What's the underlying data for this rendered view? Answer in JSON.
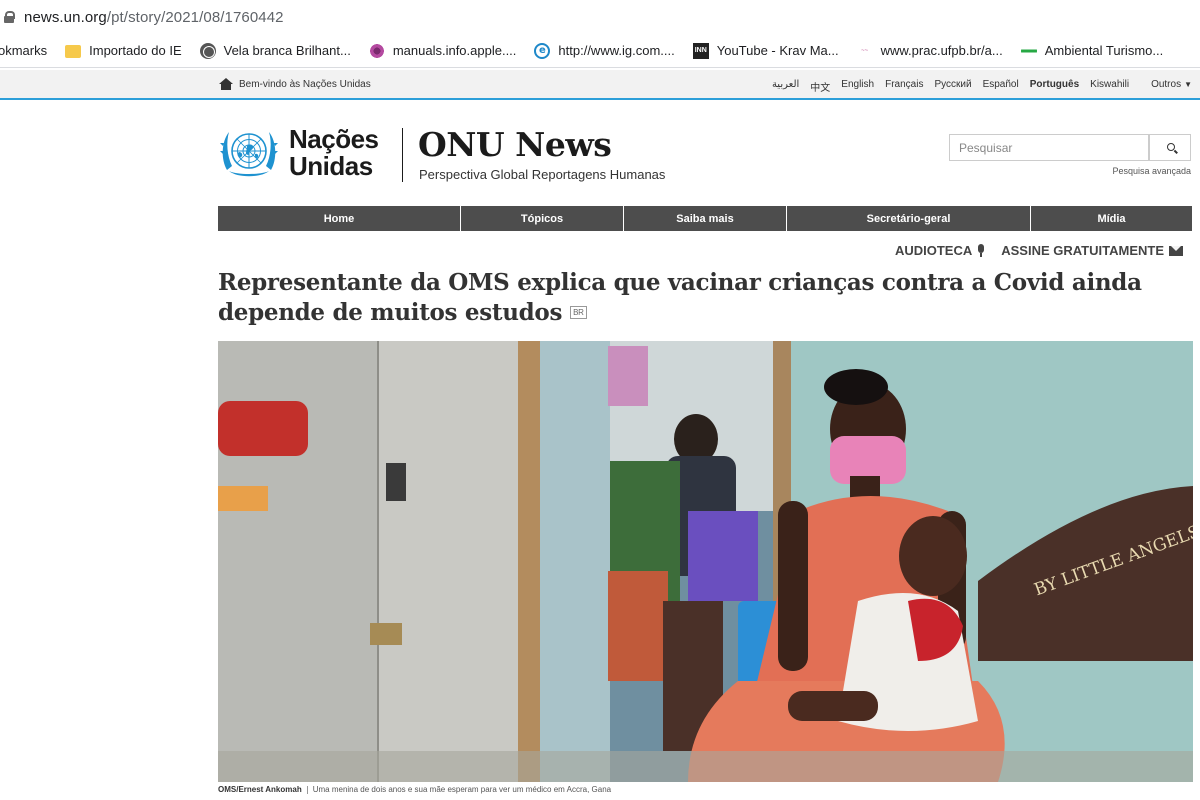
{
  "browser": {
    "url_domain": "news.un.org",
    "url_path": "/pt/story/2021/08/1760442",
    "bookmarks": [
      {
        "label": "okmarks",
        "icon": "none"
      },
      {
        "label": "Importado do IE",
        "icon": "folder-icon"
      },
      {
        "label": "Vela branca Brilhant...",
        "icon": "globe-icon"
      },
      {
        "label": "manuals.info.apple....",
        "icon": "flower-icon"
      },
      {
        "label": "http://www.ig.com....",
        "icon": "ie-icon"
      },
      {
        "label": "YouTube - Krav Ma...",
        "icon": "inn-icon"
      },
      {
        "label": "www.prac.ufpb.br/a...",
        "icon": "prac-icon"
      },
      {
        "label": "Ambiental Turismo...",
        "icon": "leaf-icon"
      }
    ]
  },
  "unbar": {
    "welcome": "Bem-vindo às Nações Unidas",
    "languages": [
      "العربية",
      "中文",
      "English",
      "Français",
      "Русский",
      "Español",
      "Português",
      "Kiswahili",
      "Outros"
    ],
    "active_language": "Português",
    "accent": "#2d9fd9"
  },
  "masthead": {
    "un_line1": "Nações",
    "un_line2": "Unidas",
    "title": "ONU News",
    "tagline": "Perspectiva Global Reportagens Humanas",
    "logo_color": "#1e92d0"
  },
  "search": {
    "placeholder": "Pesquisar",
    "advanced": "Pesquisa avançada"
  },
  "nav": {
    "items": [
      "Home",
      "Tópicos",
      "Saiba mais",
      "Secretário-geral",
      "Mídia"
    ],
    "bg": "#4d4d4d"
  },
  "utility": {
    "audioteca": "AUDIOTECA",
    "subscribe": "ASSINE GRATUITAMENTE"
  },
  "article": {
    "headline": "Representante da OMS explica que vacinar crianças contra a Covid ainda depende de muitos estudos",
    "lang_flag": "BR",
    "photo_credit": "OMS/Ernest Ankomah",
    "photo_caption": "Uma menina de dois anos e sua mãe esperam para ver um médico em Accra, Gana",
    "bench_text": "BY LITTLE ANGELS"
  }
}
